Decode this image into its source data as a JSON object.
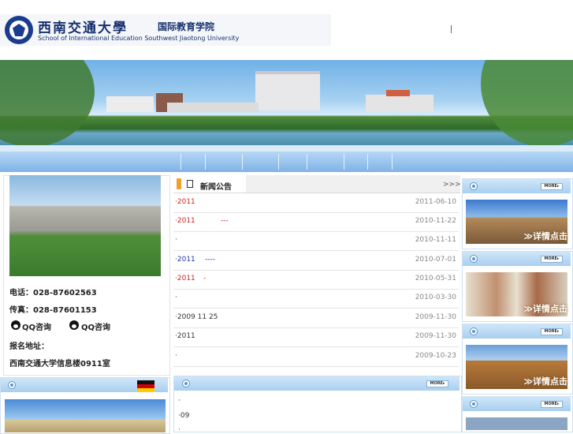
{
  "header": {
    "logo_cn": "西南交通大學",
    "logo_cn_sub": "国际教育学院",
    "logo_en": "School of International Education Southwest Jiaotong University",
    "separator": "|"
  },
  "contact": {
    "phone": "电话：028-87602563",
    "fax": "传真：028-87601153",
    "qq1": "QQ咨询",
    "qq2": "QQ咨询",
    "address_label": "报名地址：",
    "address": "西南交通大学信息楼0911室"
  },
  "news": {
    "tab_label": "新闻公告",
    "more": ">>>",
    "items": [
      {
        "title": "·2011",
        "tag": "",
        "date": "2011-06-10",
        "color": "#cc2222"
      },
      {
        "title": "·2011",
        "tag": "---",
        "date": "2010-11-22",
        "color": "#cc2222"
      },
      {
        "title": "·",
        "tag": "",
        "date": "2010-11-11",
        "color": "#333333"
      },
      {
        "title": "·2011",
        "tag": "----",
        "date": "2010-07-01",
        "color": "#2233aa"
      },
      {
        "title": "·2011",
        "tag": "-",
        "date": "2010-05-31",
        "color": "#cc2222"
      },
      {
        "title": "·",
        "tag": "",
        "date": "2010-03-30",
        "color": "#333333"
      },
      {
        "title": "·2009 11 25",
        "tag": "",
        "date": "2009-11-30",
        "color": "#333333"
      },
      {
        "title": "·2011",
        "tag": "",
        "date": "2009-11-30",
        "color": "#333333"
      },
      {
        "title": "·",
        "tag": "",
        "date": "2009-10-23",
        "color": "#333333"
      }
    ]
  },
  "news2": {
    "more": "MORE▸",
    "lines": [
      "·",
      "·09",
      "·"
    ]
  },
  "right": {
    "more": "MORE▸",
    "cta": "≫详情点击"
  },
  "icons": {
    "logo": "university-seal-icon",
    "qq": "qq-penguin-icon",
    "flag": "germany-flag-icon",
    "doc": "document-icon",
    "circle": "circle-bullet-icon"
  },
  "colors": {
    "brand_blue": "#16306e",
    "nav_blue": "#7eb2e6",
    "news_red": "#cc2222"
  }
}
